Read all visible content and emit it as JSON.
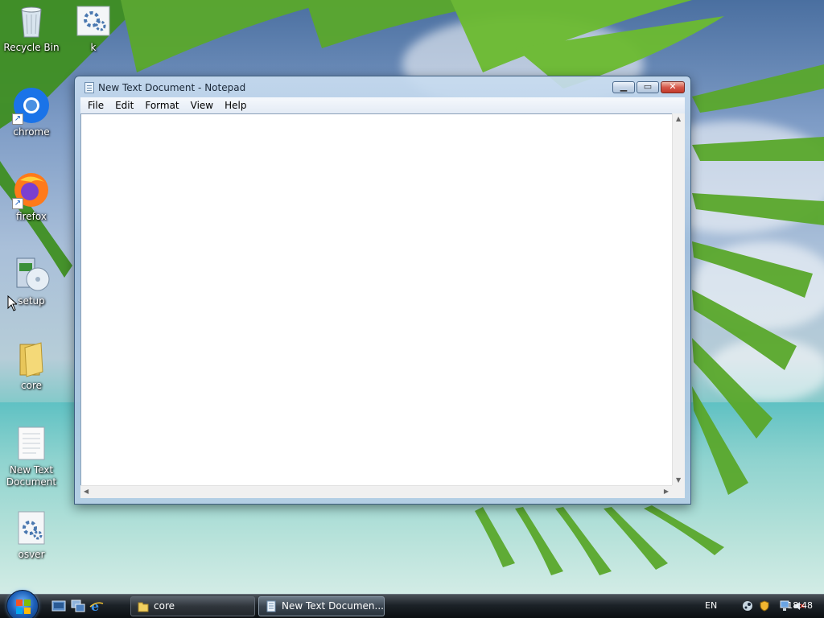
{
  "desktop": {
    "icons": [
      {
        "label": "Recycle Bin",
        "icon": "recycle-bin-icon"
      },
      {
        "label": "k",
        "icon": "settings-file-icon"
      },
      {
        "label": "chrome",
        "icon": "chrome-icon"
      },
      {
        "label": "firefox",
        "icon": "firefox-icon"
      },
      {
        "label": "setup",
        "icon": "setup-installer-icon"
      },
      {
        "label": "core",
        "icon": "folder-icon"
      },
      {
        "label": "New Text Document",
        "icon": "text-document-icon"
      },
      {
        "label": "osver",
        "icon": "settings-file-icon"
      }
    ]
  },
  "notepad": {
    "title": "New Text Document - Notepad",
    "menu": [
      "File",
      "Edit",
      "Format",
      "View",
      "Help"
    ],
    "content": ""
  },
  "taskbar": {
    "buttons": [
      {
        "label": "core",
        "icon": "folder-icon",
        "active": false
      },
      {
        "label": "New Text Documen...",
        "icon": "notepad-icon",
        "active": true
      }
    ],
    "tray": {
      "language": "EN",
      "time": "18:48"
    }
  }
}
